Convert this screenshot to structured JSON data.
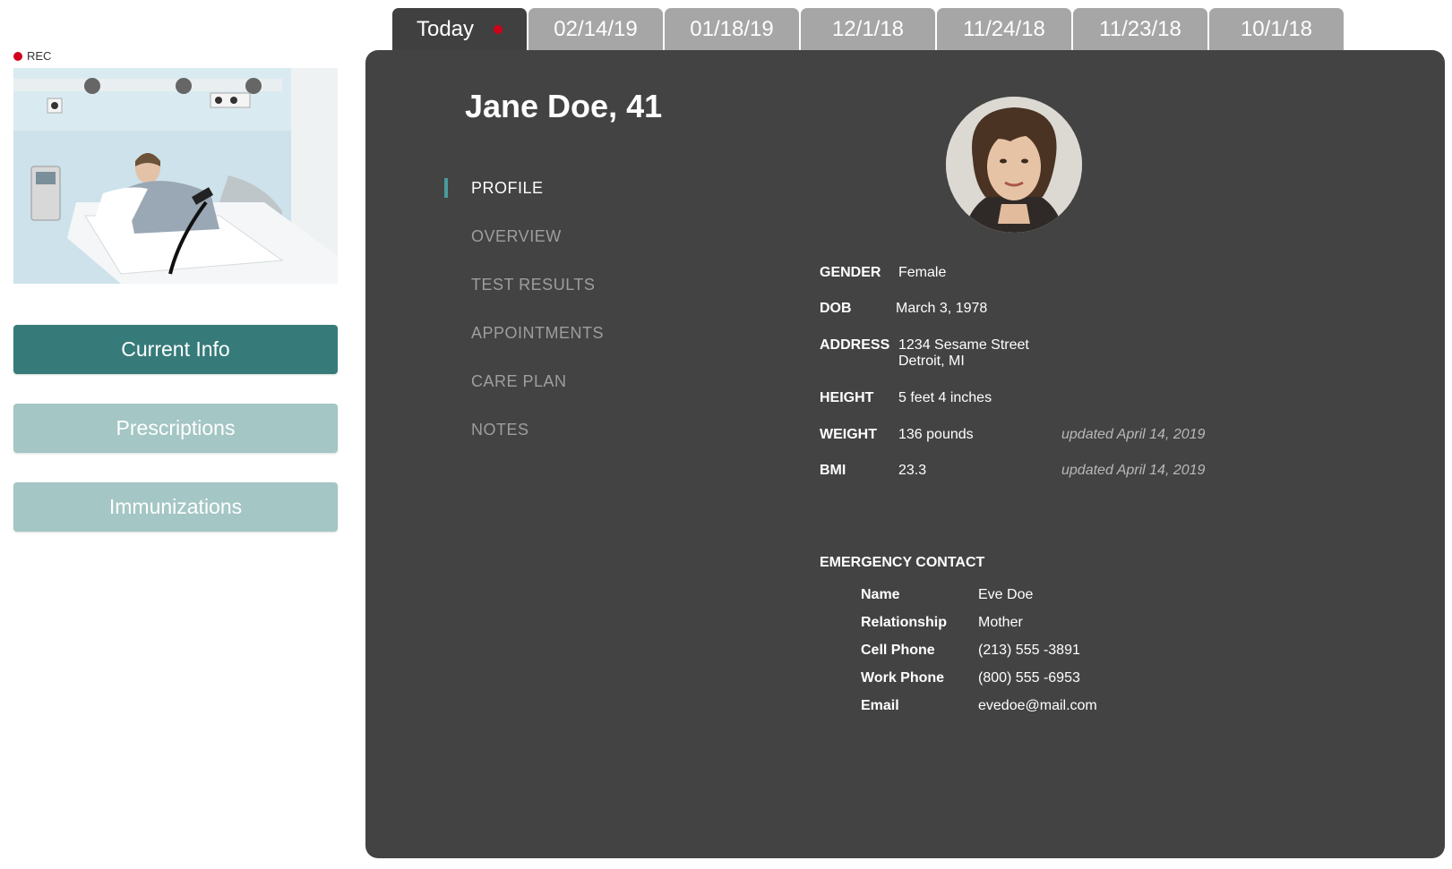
{
  "recording": {
    "label": "REC",
    "color": "#d0021b"
  },
  "video": {
    "icon": "patient-video-feed"
  },
  "sidebar": {
    "buttons": [
      {
        "label": "Current Info",
        "active": true
      },
      {
        "label": "Prescriptions",
        "active": false
      },
      {
        "label": "Immunizations",
        "active": false
      }
    ]
  },
  "tabs": [
    {
      "label": "Today",
      "active": true,
      "live_indicator": true
    },
    {
      "label": "02/14/19"
    },
    {
      "label": "01/18/19"
    },
    {
      "label": "12/1/18"
    },
    {
      "label": "11/24/18"
    },
    {
      "label": "11/23/18"
    },
    {
      "label": "10/1/18"
    }
  ],
  "patient": {
    "title": "Jane Doe, 41",
    "photo_icon": "patient-avatar"
  },
  "nav": {
    "items": [
      {
        "label": "PROFILE",
        "active": true
      },
      {
        "label": "OVERVIEW"
      },
      {
        "label": "TEST RESULTS"
      },
      {
        "label": "APPOINTMENTS"
      },
      {
        "label": "CARE PLAN"
      },
      {
        "label": "NOTES"
      }
    ]
  },
  "profile": {
    "gender": {
      "label": "GENDER",
      "value": "Female"
    },
    "dob": {
      "label": "DOB",
      "value": "March 3, 1978"
    },
    "address": {
      "label": "ADDRESS",
      "line1": "1234 Sesame Street",
      "line2": "Detroit, MI"
    },
    "height": {
      "label": "HEIGHT",
      "value": "5 feet 4 inches"
    },
    "weight": {
      "label": "WEIGHT",
      "value": "136 pounds",
      "updated": "updated April 14, 2019"
    },
    "bmi": {
      "label": "BMI",
      "value": "23.3",
      "updated": "updated April 14, 2019"
    }
  },
  "emergency_contact": {
    "title": "EMERGENCY CONTACT",
    "name": {
      "label": "Name",
      "value": "Eve Doe"
    },
    "relationship": {
      "label": "Relationship",
      "value": "Mother"
    },
    "cell_phone": {
      "label": "Cell Phone",
      "value": "(213) 555 -3891"
    },
    "work_phone": {
      "label": "Work Phone",
      "value": "(800) 555 -6953"
    },
    "email": {
      "label": "Email",
      "value": "evedoe@mail.com"
    }
  },
  "colors": {
    "accent": "#367b7a",
    "accent_light": "#a4c6c5",
    "panel": "#434343",
    "tab_inactive": "#a6a6a6",
    "nav_indicator": "#4a9a9b"
  }
}
